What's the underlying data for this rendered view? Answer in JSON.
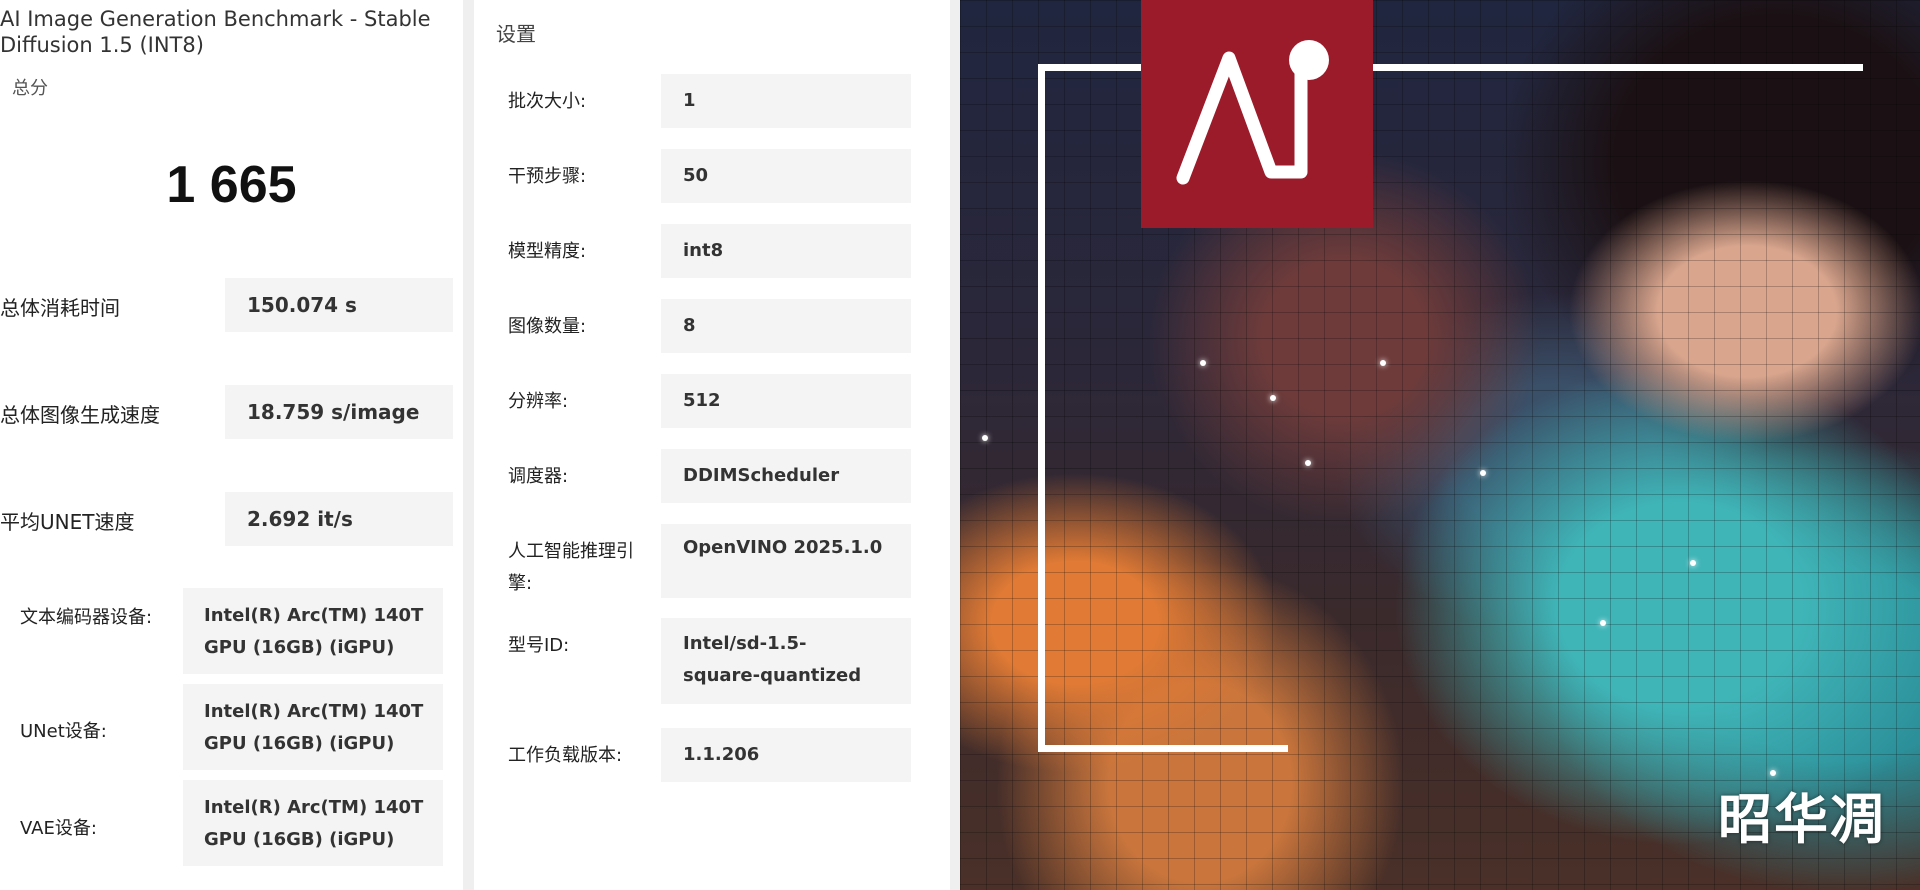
{
  "results": {
    "title": "AI Image Generation Benchmark - Stable Diffusion 1.5 (INT8)",
    "score_label": "总分",
    "score_value": "1 665",
    "metrics": [
      {
        "label": "总体消耗时间",
        "value": "150.074 s"
      },
      {
        "label": "总体图像生成速度",
        "value": "18.759 s/image"
      },
      {
        "label": "平均UNET速度",
        "value": "2.692 it/s"
      }
    ],
    "devices": [
      {
        "label": "文本编码器设备:",
        "value": "Intel(R) Arc(TM) 140T GPU (16GB) (iGPU)"
      },
      {
        "label": "UNet设备:",
        "value": "Intel(R) Arc(TM) 140T GPU (16GB) (iGPU)"
      },
      {
        "label": "VAE设备:",
        "value": "Intel(R) Arc(TM) 140T GPU (16GB) (iGPU)"
      }
    ]
  },
  "settings": {
    "title": "设置",
    "items": [
      {
        "label": "批次大小:",
        "value": "1"
      },
      {
        "label": "干预步骤:",
        "value": "50"
      },
      {
        "label": "模型精度:",
        "value": "int8"
      },
      {
        "label": "图像数量:",
        "value": "8"
      },
      {
        "label": "分辨率:",
        "value": "512"
      },
      {
        "label": "调度器:",
        "value": "DDIMScheduler"
      },
      {
        "label": "人工智能推理引擎:",
        "value": "OpenVINO 2025.1.0"
      },
      {
        "label": "型号ID:",
        "value": "Intel/sd-1.5-square-quantized"
      },
      {
        "label": "工作负载版本:",
        "value": "1.1.206"
      }
    ]
  },
  "hero": {
    "logo_text": "AI",
    "logo_color": "#9b1b2a",
    "watermark": "昭华凋"
  }
}
